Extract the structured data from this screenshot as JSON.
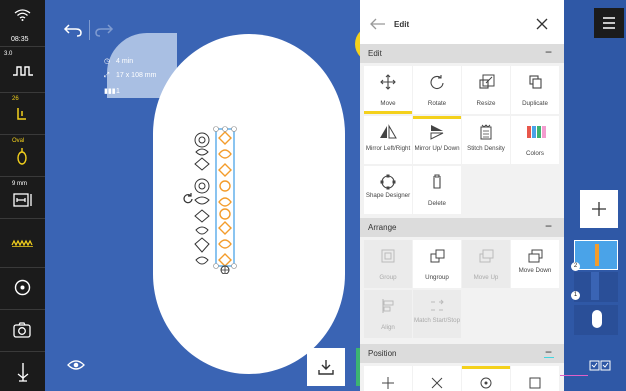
{
  "status": {
    "time": "08:35"
  },
  "rail": {
    "speed_label": "3.0",
    "tension_label": "26",
    "foot_label": "Oval",
    "width_label": "9 mm"
  },
  "canvas": {
    "info": {
      "time": "4 min",
      "size": "17 x 108 mm",
      "colors": "1"
    }
  },
  "panel": {
    "title": "Edit",
    "sections": {
      "edit": "Edit",
      "arrange": "Arrange",
      "position": "Position"
    },
    "edit_tools": [
      {
        "label": "Move",
        "icon": "move-icon",
        "selected": true
      },
      {
        "label": "Rotate",
        "icon": "rotate-icon",
        "selected": false
      },
      {
        "label": "Resize",
        "icon": "resize-icon",
        "selected": false
      },
      {
        "label": "Duplicate",
        "icon": "duplicate-icon",
        "selected": false
      },
      {
        "label": "Mirror Left/Right",
        "icon": "mirror-left-right-icon",
        "selected": false
      },
      {
        "label": "Mirror Up/ Down",
        "icon": "mirror-up-down-icon",
        "selected": true
      },
      {
        "label": "Stitch Density",
        "icon": "stitch-density-icon",
        "selected": false
      },
      {
        "label": "Colors",
        "icon": "colors-icon",
        "selected": false
      },
      {
        "label": "Shape Designer",
        "icon": "shape-designer-icon",
        "selected": false
      },
      {
        "label": "Delete",
        "icon": "trash-icon",
        "selected": false
      }
    ],
    "arrange_tools": [
      {
        "label": "Group",
        "enabled": false
      },
      {
        "label": "Ungroup",
        "enabled": true
      },
      {
        "label": "Move Up",
        "enabled": false
      },
      {
        "label": "Move Down",
        "enabled": true
      },
      {
        "label": "Align",
        "enabled": false
      },
      {
        "label": "Match Start/Stop",
        "enabled": false
      }
    ]
  },
  "layers": {
    "badge_1": "2",
    "badge_2": "1"
  },
  "colors": {
    "accent": "#f4d11c",
    "canvas_bg": "#3a64b4",
    "done_button": "#3cb371",
    "embroidery_dark": "#333333",
    "embroidery_orange": "#f39c2b",
    "selection_blue": "#4aa3e8"
  }
}
